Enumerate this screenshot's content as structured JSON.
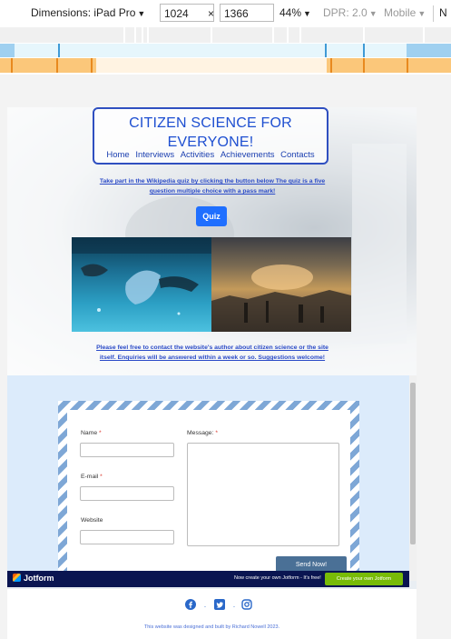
{
  "devtools": {
    "dimensions_label": "Dimensions: iPad Pro",
    "width": "1024",
    "times": "×",
    "height": "1366",
    "zoom": "44%",
    "dpr": "DPR: 2.0",
    "mode": "Mobile",
    "overflow": "N"
  },
  "site": {
    "title": "CITIZEN SCIENCE FOR EVERYONE!",
    "nav": [
      "Home",
      "Interviews",
      "Activities",
      "Achievements",
      "Contacts"
    ],
    "intro": "Take part in the Wikipedia quiz by clicking the button below The quiz is a five question multiple choice with a pass mark!",
    "quiz_button": "Quiz",
    "contact_text": "Please feel free to contact the website's author about citizen science or the site itself. Enquiries will be answered within a week or so. Suggestions welcome!"
  },
  "form": {
    "name_label": "Name",
    "email_label": "E-mail",
    "website_label": "Website",
    "message_label": "Message:",
    "required_mark": "*",
    "send_button": "Send Now!"
  },
  "jotform": {
    "logo": "Jotform",
    "message": "Now create your own Jotform - It's free!",
    "cta": "Create your own Jotform"
  },
  "footer": {
    "separator": ".",
    "credit": "This website was designed and built by Richard Nowell 2023."
  },
  "icons": {
    "facebook": "facebook-icon",
    "twitter": "twitter-icon",
    "instagram": "instagram-icon"
  },
  "colors": {
    "brand_blue": "#1e4fd1",
    "quiz_button": "#1f6fff",
    "send_button": "#4a7096",
    "jotform_bar": "#0a1551",
    "jotform_cta": "#78bb07"
  }
}
